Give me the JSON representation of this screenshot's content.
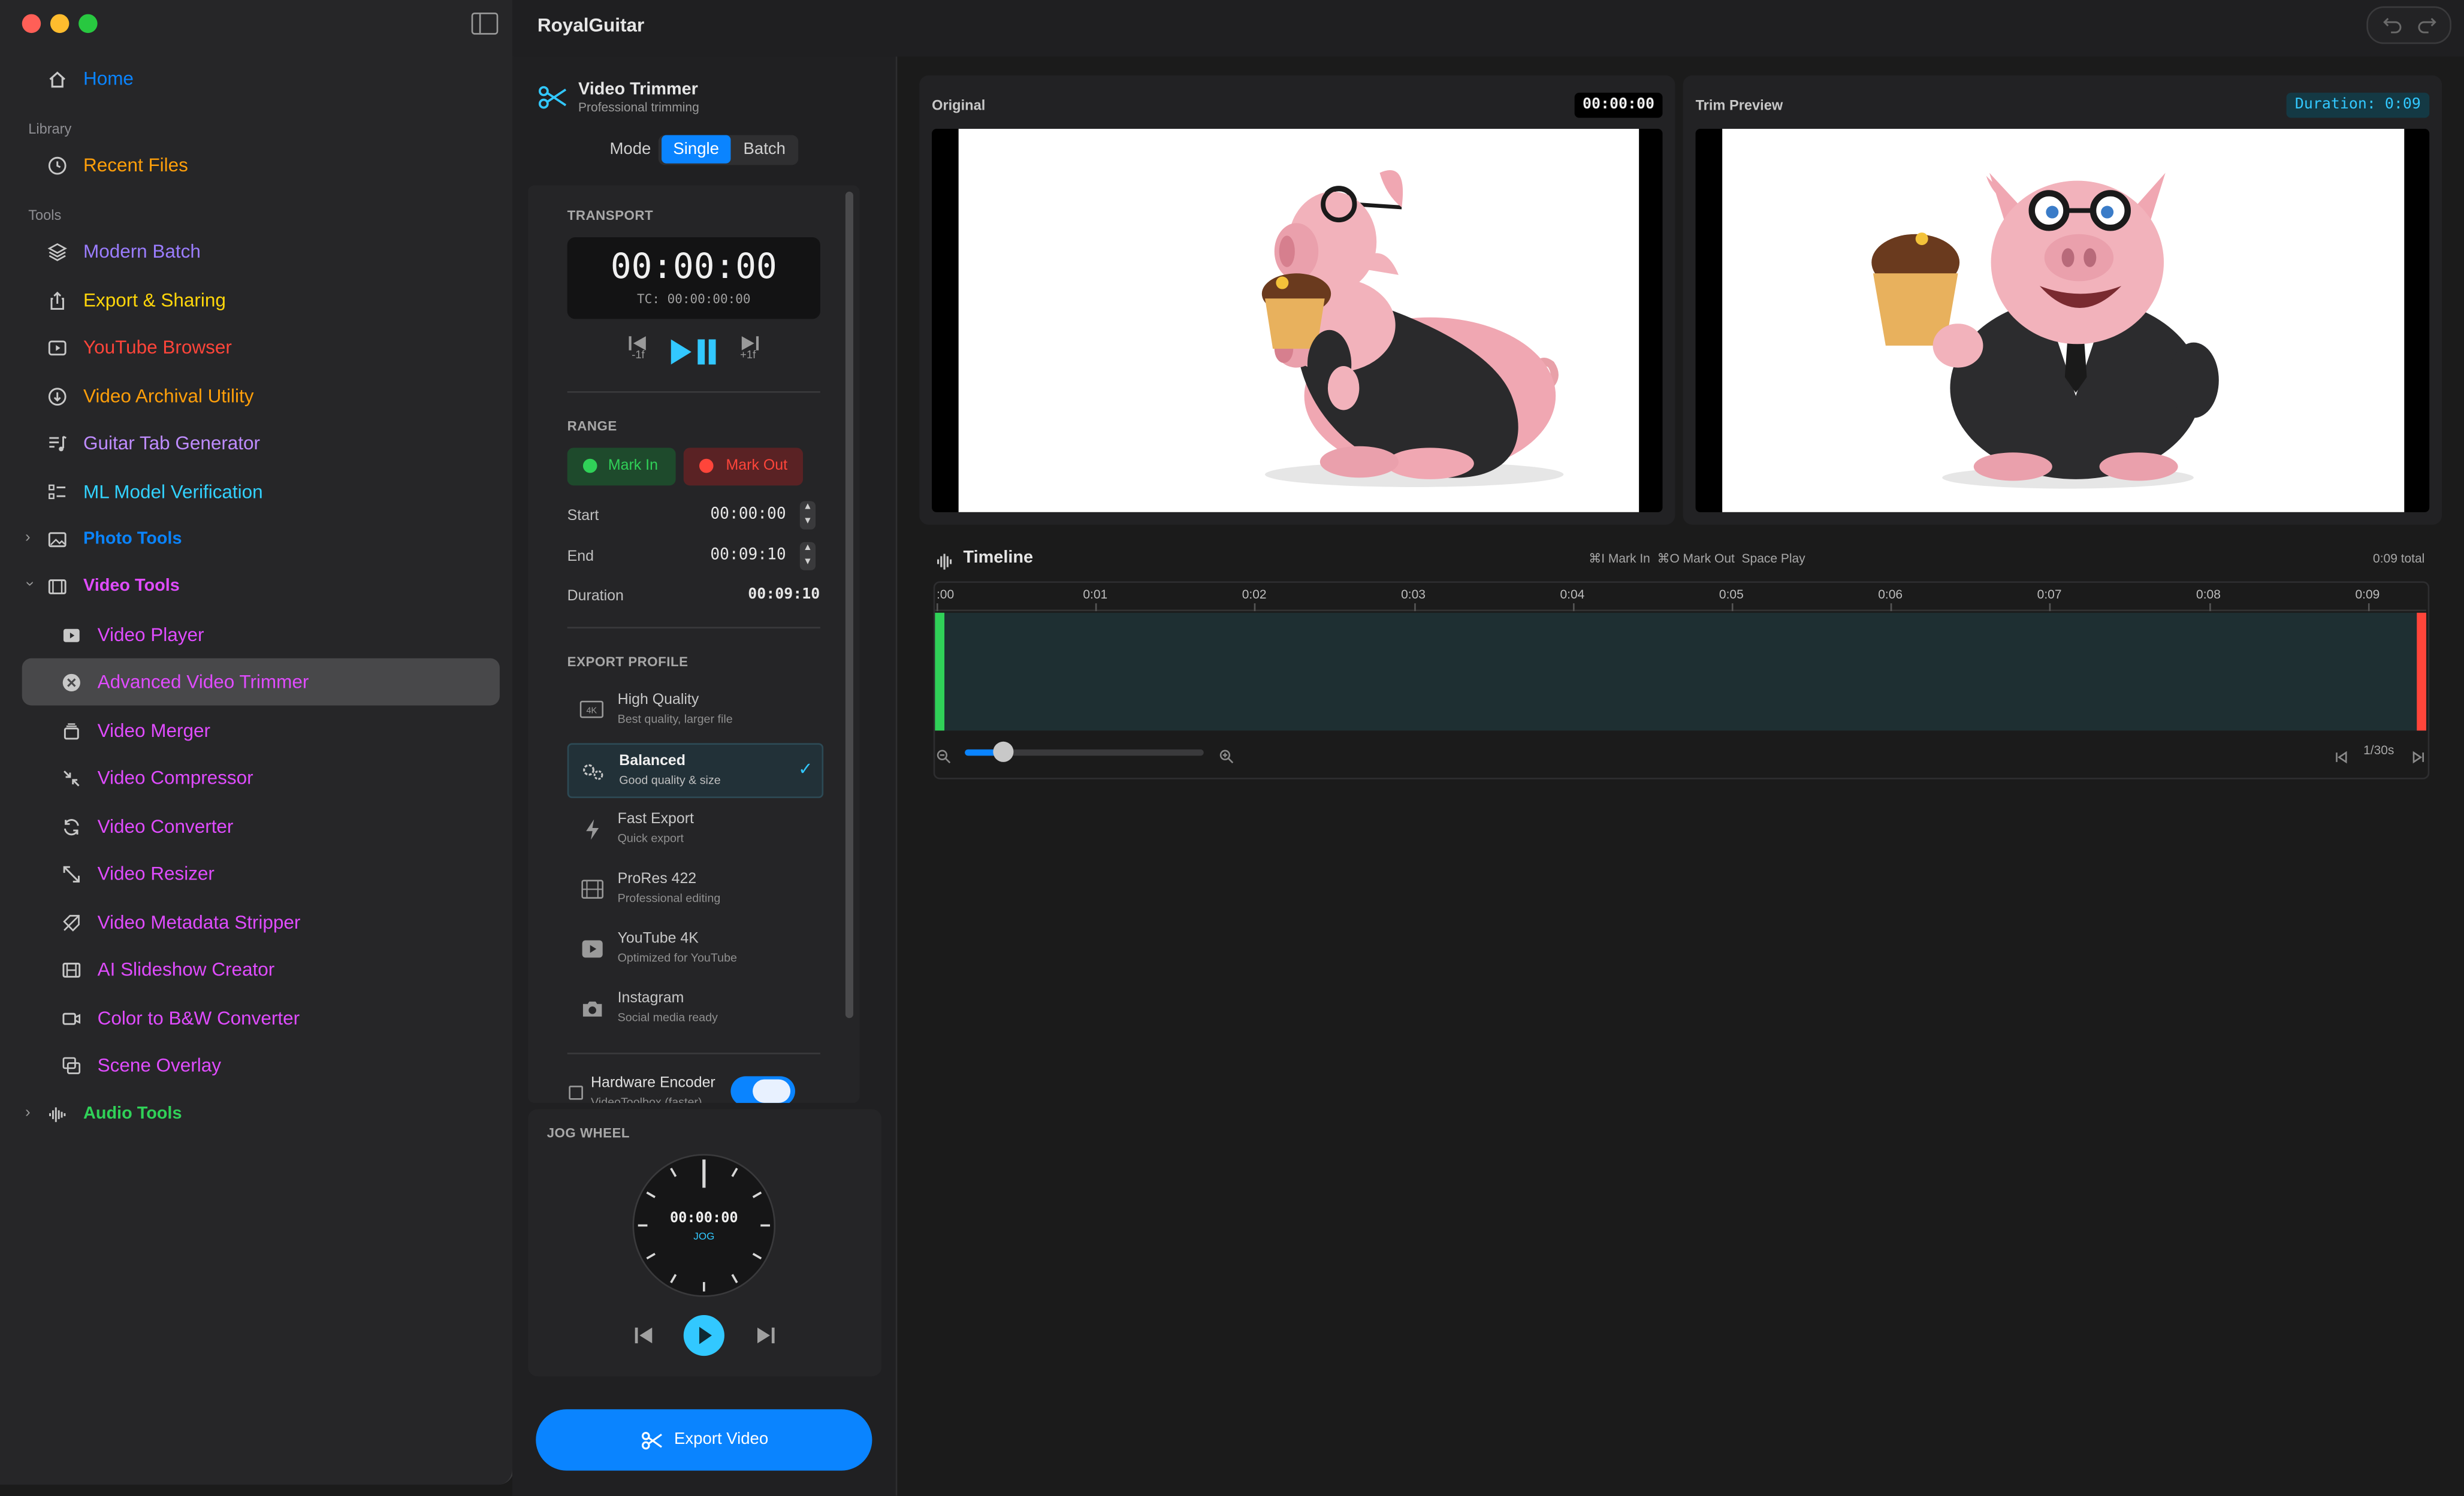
{
  "window": {
    "title": "RoyalGuitar"
  },
  "sidebar": {
    "home": "Home",
    "library_header": "Library",
    "recent_files": "Recent Files",
    "tools_header": "Tools",
    "tools": [
      {
        "label": "Modern Batch",
        "color": "#9b7dff"
      },
      {
        "label": "Export & Sharing",
        "color": "#ffd60a"
      },
      {
        "label": "YouTube Browser",
        "color": "#ff453a"
      },
      {
        "label": "Video Archival Utility",
        "color": "#ff9f0a"
      },
      {
        "label": "Guitar Tab Generator",
        "color": "#bf8cff"
      },
      {
        "label": "ML Model Verification",
        "color": "#32d2ff"
      }
    ],
    "photo_tools": "Photo Tools",
    "video_tools": "Video Tools",
    "video_items": [
      "Video Player",
      "Advanced Video Trimmer",
      "Video Merger",
      "Video Compressor",
      "Video Converter",
      "Video Resizer",
      "Video Metadata Stripper",
      "AI Slideshow Creator",
      "Color to B&W Converter",
      "Scene Overlay"
    ],
    "audio_tools": "Audio Tools",
    "colors": {
      "link": "#0a84ff",
      "orange": "#ff9f0a",
      "magenta": "#e04cff",
      "green": "#30d158"
    }
  },
  "trimmer": {
    "title": "Video Trimmer",
    "subtitle": "Professional trimming",
    "mode_label": "Mode",
    "mode_options": [
      "Single",
      "Batch"
    ],
    "transport_header": "TRANSPORT",
    "timecode": "00:00:00",
    "tc_line": "TC: 00:00:00:00",
    "step_back": "-1f",
    "step_fwd": "+1f",
    "range_header": "RANGE",
    "mark_in": "Mark In",
    "mark_out": "Mark Out",
    "start_label": "Start",
    "start_value": "00:00:00",
    "end_label": "End",
    "end_value": "00:09:10",
    "duration_label": "Duration",
    "duration_value": "00:09:10",
    "export_profile_header": "EXPORT PROFILE",
    "profiles": [
      {
        "title": "High Quality",
        "sub": "Best quality, larger file",
        "icon": "4k-icon"
      },
      {
        "title": "Balanced",
        "sub": "Good quality & size",
        "icon": "gears-icon",
        "selected": true
      },
      {
        "title": "Fast Export",
        "sub": "Quick export",
        "icon": "bolt-icon"
      },
      {
        "title": "ProRes 422",
        "sub": "Professional editing",
        "icon": "film-icon"
      },
      {
        "title": "YouTube 4K",
        "sub": "Optimized for YouTube",
        "icon": "play-icon"
      },
      {
        "title": "Instagram",
        "sub": "Social media ready",
        "icon": "camera-icon"
      }
    ],
    "hw_encoder": "Hardware Encoder",
    "hw_encoder_sub": "VideoToolbox (faster)",
    "jog_header": "JOG WHEEL",
    "jog_time": "00:00:00",
    "jog_label": "JOG",
    "export_button": "Export Video"
  },
  "preview": {
    "original_label": "Original",
    "original_time": "00:00:00",
    "trim_label": "Trim Preview",
    "trim_duration": "Duration: 0:09"
  },
  "timeline": {
    "title": "Timeline",
    "shortcuts": "⌘I Mark In  ⌘O Mark Out  Space Play",
    "total": "0:09 total",
    "ticks": [
      ":00",
      "0:01",
      "0:02",
      "0:03",
      "0:04",
      "0:05",
      "0:06",
      "0:07",
      "0:08",
      "0:09"
    ],
    "frame_rate": "1/30s",
    "zoom_level": 0.12
  }
}
